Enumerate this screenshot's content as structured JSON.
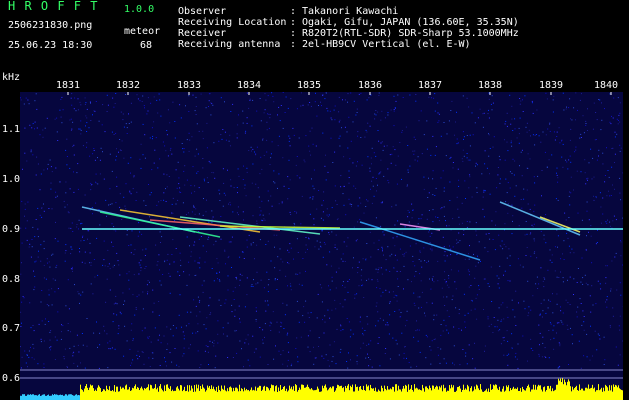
{
  "header": {
    "app_name": "H R O F F T",
    "version": "1.0.0",
    "filename": "2506231830.png",
    "category": "meteor",
    "datetime": "25.06.23 18:30",
    "count": "68",
    "info_labels": [
      "Observer",
      "Receiving Location",
      "Receiver",
      "Receiving antenna"
    ],
    "info_values": [
      "Takanori Kawachi",
      "Ogaki, Gifu, JAPAN (136.60E, 35.35N)",
      "R820T2(RTL-SDR) SDR-Sharp 53.1000MHz",
      "2el-HB9CV Vertical (el. E-W)"
    ],
    "separator": ":"
  },
  "axis": {
    "y_unit": "kHz",
    "y_ticks": [
      "1.1",
      "1.0",
      "0.9",
      "0.8",
      "0.7",
      "0.6"
    ],
    "x_ticks": [
      "1831",
      "1832",
      "1833",
      "1834",
      "1835",
      "1836",
      "1837",
      "1838",
      "1839",
      "1840"
    ]
  },
  "colors": {
    "background": "#000000",
    "noise_base": "#0a0a5a",
    "header_green": "#33ff66",
    "carrier_line": "#66ffff",
    "histogram": "#ffff00"
  }
}
